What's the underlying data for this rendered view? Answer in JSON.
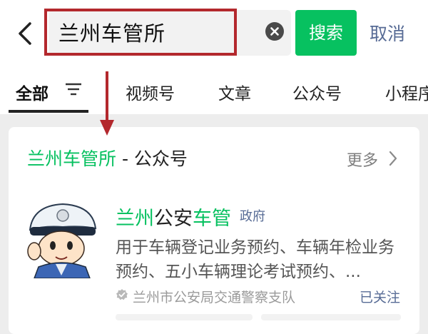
{
  "search": {
    "query": "兰州车管所",
    "button_label": "搜索",
    "cancel_label": "取消"
  },
  "tabs": [
    {
      "label": "全部"
    },
    {
      "label": "视频号"
    },
    {
      "label": "文章"
    },
    {
      "label": "公众号"
    },
    {
      "label": "小程序"
    }
  ],
  "section": {
    "title_highlight": "兰州车管所",
    "title_rest": " - 公众号",
    "more_label": "更多"
  },
  "account": {
    "name_part1": "兰州",
    "name_part2": "公安",
    "name_part3": "车管",
    "tag": "政府",
    "description": "用于车辆登记业务预约、车辆年检业务预约、五小车辆理论考试预约、...",
    "subject": "兰州市公安局交通警察支队",
    "follow_status": "已关注"
  },
  "colors": {
    "accent_green": "#07c160",
    "link_blue": "#576b95",
    "annotation_red": "#b3282d"
  }
}
